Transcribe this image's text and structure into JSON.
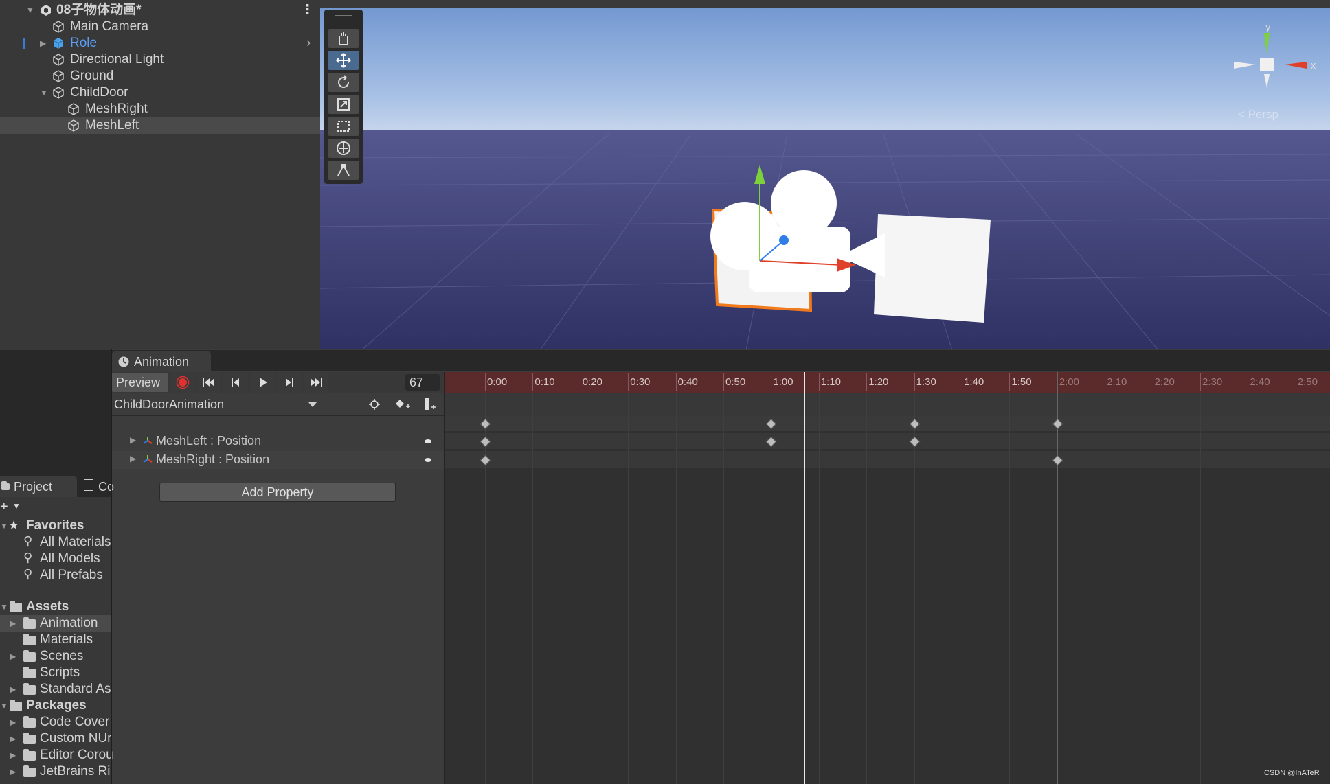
{
  "hierarchy": {
    "scene_name": "08子物体动画*",
    "items": [
      {
        "label": "Main Camera"
      },
      {
        "label": "Role"
      },
      {
        "label": "Directional Light"
      },
      {
        "label": "Ground"
      },
      {
        "label": "ChildDoor"
      },
      {
        "label": "MeshRight"
      },
      {
        "label": "MeshLeft"
      }
    ],
    "menu_icon": "kebab-menu-icon"
  },
  "scene_view": {
    "gizmo_axes": {
      "y": "y",
      "x": "x"
    },
    "projection_label": "< Persp",
    "colors": {
      "sky_top": "#7aa0d6",
      "ground": "#3b3f7a",
      "axis_x": "#e0402a",
      "axis_y": "#7ed13a",
      "axis_z": "#2f7de6",
      "selection_outline": "#f07a1c"
    }
  },
  "animation": {
    "tab_label": "Animation",
    "preview_label": "Preview",
    "frame_value": "67",
    "clip_name": "ChildDoorAnimation",
    "properties": [
      {
        "label": "MeshLeft : Position"
      },
      {
        "label": "MeshRight : Position"
      }
    ],
    "add_property_label": "Add Property",
    "ruler_ticks": [
      "0:00",
      "0:10",
      "0:20",
      "0:30",
      "0:40",
      "0:50",
      "1:00",
      "1:10",
      "1:20",
      "1:30",
      "1:40",
      "1:50",
      "2:00",
      "2:10",
      "2:20",
      "2:30",
      "2:40",
      "2:50"
    ],
    "keyframes": {
      "summary": [
        "0:00",
        "1:00",
        "1:30",
        "2:00"
      ],
      "meshleft": [
        "0:00",
        "1:00",
        "1:30"
      ],
      "meshright": [
        "0:00",
        "2:00"
      ]
    },
    "playhead": "1:07",
    "colors": {
      "record": "#e03030",
      "ruler": "#5b2a2a"
    }
  },
  "project": {
    "tabs": [
      {
        "label": "Project"
      },
      {
        "label": "Co"
      }
    ],
    "favorites_label": "Favorites",
    "favorites": [
      {
        "label": "All Materials"
      },
      {
        "label": "All Models"
      },
      {
        "label": "All Prefabs"
      }
    ],
    "assets_label": "Assets",
    "assets": [
      {
        "label": "Animation"
      },
      {
        "label": "Materials"
      },
      {
        "label": "Scenes"
      },
      {
        "label": "Scripts"
      },
      {
        "label": "Standard As"
      }
    ],
    "packages_label": "Packages",
    "packages": [
      {
        "label": "Code Cover"
      },
      {
        "label": "Custom NUr"
      },
      {
        "label": "Editor Corou"
      },
      {
        "label": "JetBrains Ri"
      }
    ]
  },
  "watermark": "CSDN @InATeR"
}
